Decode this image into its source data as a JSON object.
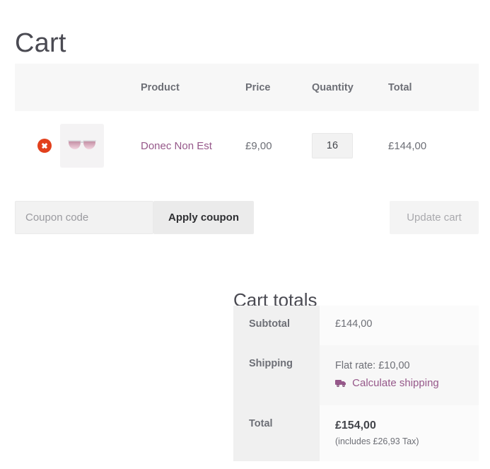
{
  "page": {
    "title": "Cart"
  },
  "cart_table": {
    "headers": {
      "remove": "",
      "thumbnail": "",
      "product": "Product",
      "price": "Price",
      "quantity": "Quantity",
      "total": "Total"
    },
    "rows": [
      {
        "remove_icon": "remove-circle-icon",
        "thumbnail_icon": "sunglasses-thumbnail",
        "product_name": "Donec Non Est",
        "price": "£9,00",
        "quantity": "16",
        "line_total": "£144,00"
      }
    ]
  },
  "actions": {
    "coupon_placeholder": "Coupon code",
    "coupon_value": "",
    "apply_coupon_label": "Apply coupon",
    "update_cart_label": "Update cart"
  },
  "cart_totals": {
    "title": "Cart totals",
    "rows": [
      {
        "label": "Subtotal",
        "value": "£144,00"
      },
      {
        "label": "Shipping",
        "method": "Flat rate: £10,00",
        "calculate_link": "Calculate shipping",
        "link_icon": "delivery-truck-icon"
      },
      {
        "label": "Total",
        "value": "£154,00",
        "tax_note": "(includes £26,93 Tax)"
      }
    ]
  },
  "colors": {
    "link": "#96588a",
    "remove_button": "#e2401c",
    "header_band": "#f7f7f7",
    "text": "#6d6f76",
    "title": "#4a4a52"
  }
}
